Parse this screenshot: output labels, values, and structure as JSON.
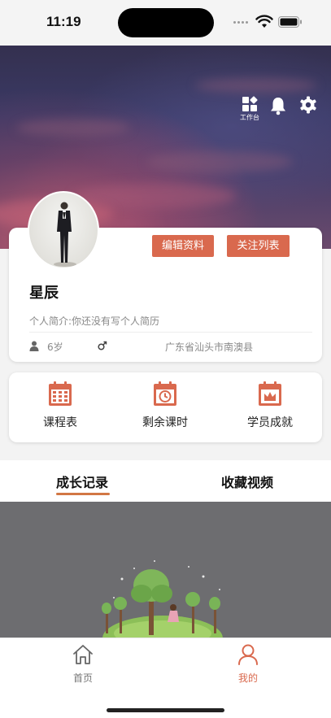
{
  "status_bar": {
    "time": "11:19"
  },
  "header": {
    "workbench_label": "工作台"
  },
  "profile": {
    "edit_button": "编辑资料",
    "follow_button": "关注列表",
    "nickname": "星辰",
    "bio_label": "个人简介:",
    "bio_text": "你还没有写个人简历",
    "age": "6岁",
    "location": "广东省汕头市南澳县"
  },
  "actions": [
    {
      "label": "课程表",
      "icon": "calendar-grid-icon"
    },
    {
      "label": "剩余课时",
      "icon": "calendar-clock-icon"
    },
    {
      "label": "学员成就",
      "icon": "calendar-crown-icon"
    }
  ],
  "tabs": [
    {
      "label": "成长记录",
      "active": true
    },
    {
      "label": "收藏视频",
      "active": false
    }
  ],
  "bottom_nav": [
    {
      "label": "首页",
      "icon": "home-icon",
      "active": false
    },
    {
      "label": "我的",
      "icon": "user-icon",
      "active": true
    }
  ],
  "colors": {
    "accent": "#d9694e",
    "tab_underline": "#d27744"
  }
}
